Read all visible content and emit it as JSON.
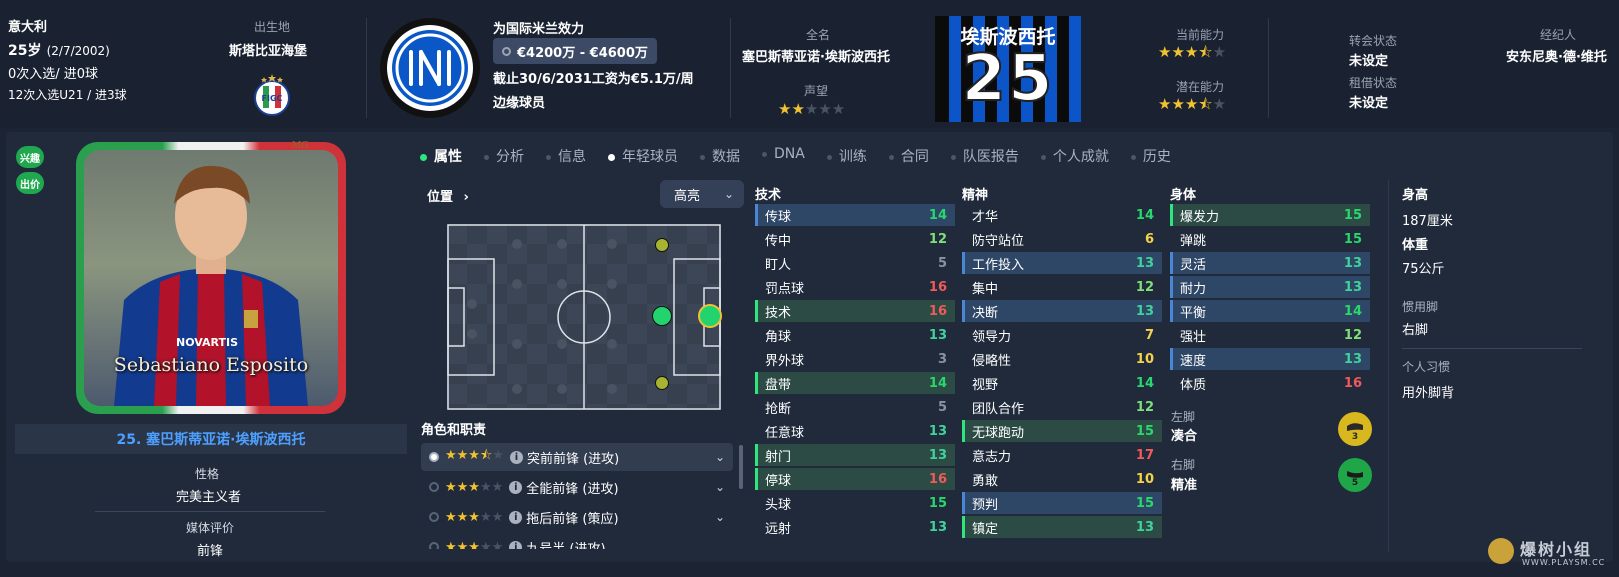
{
  "header": {
    "nationality": "意大利",
    "age": "25岁",
    "dob": "(2/7/2002)",
    "caps": "0次入选/ 进0球",
    "u21": "12次入选U21 / 进3球",
    "birthplace_label": "出生地",
    "birthplace": "斯塔比亚海堡",
    "club_label": "为国际米兰效力",
    "value_range": "€4200万 - €4600万",
    "contract": "截止30/6/2031工资为€5.1万/周",
    "squad_status": "边缘球员",
    "fullname_label": "全名",
    "fullname": "塞巴斯蒂亚诺·埃斯波西托",
    "reputation_label": "声望",
    "reputation_stars": 2,
    "shirt_name": "埃斯波西托",
    "shirt_number": "25",
    "ca_label": "当前能力",
    "ca_stars": 3.5,
    "pa_label": "潜在能力",
    "pa_stars": 3.5,
    "transfer_label": "转会状态",
    "transfer_value": "未设定",
    "loan_label": "租借状态",
    "loan_value": "未设定",
    "agent_label": "经纪人",
    "agent": "安东尼奥·德·维托"
  },
  "badges": {
    "interest": "兴趣",
    "offer": "出价"
  },
  "card": {
    "name_plate": "Sebastiano Esposito",
    "corner_mark": "MG",
    "player_title": "25. 塞巴斯蒂亚诺·埃斯波西托",
    "personality_label": "性格",
    "personality": "完美主义者",
    "media_label": "媒体评价",
    "media": "前锋"
  },
  "tabs": [
    "属性",
    "分析",
    "信息",
    "年轻球员",
    "数据",
    "DNA",
    "训练",
    "合同",
    "队医报告",
    "个人成就",
    "历史"
  ],
  "position": {
    "label": "位置",
    "highlight_dropdown": "高亮"
  },
  "roles": {
    "label": "角色和职责",
    "items": [
      {
        "stars": 3.5,
        "name": "突前前锋 (进攻)"
      },
      {
        "stars": 3,
        "name": "全能前锋 (进攻)"
      },
      {
        "stars": 3,
        "name": "拖后前锋 (策应)"
      },
      {
        "stars": 3,
        "name": "九号半 (进攻)"
      }
    ]
  },
  "technical": {
    "label": "技术",
    "rows": [
      {
        "name": "传球",
        "value": "14",
        "hl": "blue",
        "color": "green"
      },
      {
        "name": "传中",
        "value": "12",
        "hl": "",
        "color": "lgreen"
      },
      {
        "name": "盯人",
        "value": "5",
        "hl": "",
        "color": "grey"
      },
      {
        "name": "罚点球",
        "value": "16",
        "hl": "",
        "color": "red"
      },
      {
        "name": "技术",
        "value": "16",
        "hl": "green",
        "color": "red"
      },
      {
        "name": "角球",
        "value": "13",
        "hl": "",
        "color": "teal"
      },
      {
        "name": "界外球",
        "value": "3",
        "hl": "",
        "color": "grey"
      },
      {
        "name": "盘带",
        "value": "14",
        "hl": "green",
        "color": "green"
      },
      {
        "name": "抢断",
        "value": "5",
        "hl": "",
        "color": "grey"
      },
      {
        "name": "任意球",
        "value": "13",
        "hl": "",
        "color": "teal"
      },
      {
        "name": "射门",
        "value": "13",
        "hl": "green",
        "color": "teal"
      },
      {
        "name": "停球",
        "value": "16",
        "hl": "green",
        "color": "red"
      },
      {
        "name": "头球",
        "value": "15",
        "hl": "",
        "color": "green"
      },
      {
        "name": "远射",
        "value": "13",
        "hl": "",
        "color": "teal"
      }
    ]
  },
  "mental": {
    "label": "精神",
    "rows": [
      {
        "name": "才华",
        "value": "14",
        "hl": "",
        "color": "green"
      },
      {
        "name": "防守站位",
        "value": "6",
        "hl": "",
        "color": "yellow"
      },
      {
        "name": "工作投入",
        "value": "13",
        "hl": "blue",
        "color": "teal"
      },
      {
        "name": "集中",
        "value": "12",
        "hl": "",
        "color": "lgreen"
      },
      {
        "name": "决断",
        "value": "13",
        "hl": "blue",
        "color": "teal"
      },
      {
        "name": "领导力",
        "value": "7",
        "hl": "",
        "color": "yellow"
      },
      {
        "name": "侵略性",
        "value": "10",
        "hl": "",
        "color": "yellow"
      },
      {
        "name": "视野",
        "value": "14",
        "hl": "",
        "color": "green"
      },
      {
        "name": "团队合作",
        "value": "12",
        "hl": "",
        "color": "lgreen"
      },
      {
        "name": "无球跑动",
        "value": "15",
        "hl": "green",
        "color": "green"
      },
      {
        "name": "意志力",
        "value": "17",
        "hl": "",
        "color": "red"
      },
      {
        "name": "勇敢",
        "value": "10",
        "hl": "",
        "color": "yellow"
      },
      {
        "name": "预判",
        "value": "15",
        "hl": "blue",
        "color": "green"
      },
      {
        "name": "镇定",
        "value": "13",
        "hl": "green",
        "color": "teal"
      }
    ]
  },
  "physical": {
    "label": "身体",
    "rows": [
      {
        "name": "爆发力",
        "value": "15",
        "hl": "green",
        "color": "green"
      },
      {
        "name": "弹跳",
        "value": "15",
        "hl": "",
        "color": "green"
      },
      {
        "name": "灵活",
        "value": "13",
        "hl": "blue",
        "color": "teal"
      },
      {
        "name": "耐力",
        "value": "13",
        "hl": "blue",
        "color": "teal"
      },
      {
        "name": "平衡",
        "value": "14",
        "hl": "blue",
        "color": "green"
      },
      {
        "name": "强壮",
        "value": "12",
        "hl": "",
        "color": "lgreen"
      },
      {
        "name": "速度",
        "value": "13",
        "hl": "blue",
        "color": "teal"
      },
      {
        "name": "体质",
        "value": "16",
        "hl": "",
        "color": "red"
      }
    ]
  },
  "feet": {
    "left_label": "左脚",
    "left_value": "凑合",
    "left_badge": "3",
    "right_label": "右脚",
    "right_value": "精准",
    "right_badge": "5"
  },
  "info": {
    "height_label": "身高",
    "height": "187厘米",
    "weight_label": "体重",
    "weight": "75公斤",
    "foot_label": "惯用脚",
    "foot": "右脚",
    "habit_label": "个人习惯",
    "habit": "用外脚背"
  },
  "watermark": {
    "brand": "爆树小组",
    "url": "WWW.PLAYSM.CC"
  },
  "colors": {
    "bg": "#1c2434",
    "panel": "#202a3b",
    "accent_green": "#2ee57e",
    "star": "#f2c230"
  }
}
